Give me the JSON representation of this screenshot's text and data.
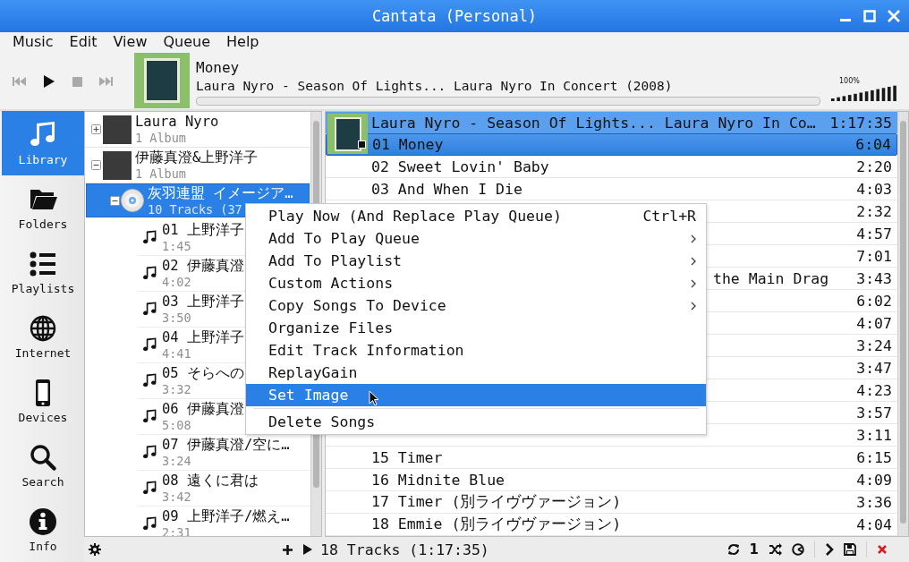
{
  "window": {
    "title": "Cantata (Personal)"
  },
  "menu_bar": [
    {
      "label": "Music"
    },
    {
      "label": "Edit"
    },
    {
      "label": "View"
    },
    {
      "label": "Queue"
    },
    {
      "label": "Help"
    }
  ],
  "transport": [
    {
      "kind": "previous",
      "disabled": true
    },
    {
      "kind": "play",
      "disabled": false
    },
    {
      "kind": "stop",
      "disabled": true
    },
    {
      "kind": "next",
      "disabled": true
    }
  ],
  "now_playing": {
    "title": "Money",
    "subtitle": "Laura Nyro - Season Of Lights... Laura Nyro In Concert (2008)",
    "level": 0
  },
  "volume": {
    "reading": "100%",
    "level": 1
  },
  "sidebar": {
    "items": [
      {
        "label": "Library",
        "selected": true
      },
      {
        "label": "Folders",
        "selected": false
      },
      {
        "label": "Playlists",
        "selected": false
      },
      {
        "label": "Internet",
        "selected": false
      },
      {
        "label": "Devices",
        "selected": false
      },
      {
        "label": "Search",
        "selected": false
      },
      {
        "label": "Info",
        "selected": false
      }
    ]
  },
  "library": {
    "artists": [
      {
        "name": "Laura Nyro",
        "subtitle": "1 Album",
        "expanded": false
      },
      {
        "name": "伊藤真澄&上野洋子",
        "subtitle": "1 Album",
        "expanded": true,
        "children": [
          {
            "title": "灰羽連盟 イメージア…",
            "subtitle": "10 Tracks (37",
            "expanded": true,
            "selected": true,
            "children": [
              {
                "title": "01 上野洋子",
                "duration": "1:45"
              },
              {
                "title": "02 伊藤真澄",
                "duration": "4:02"
              },
              {
                "title": "03 上野洋子",
                "duration": "3:50"
              },
              {
                "title": "04 上野洋子",
                "duration": "4:41"
              },
              {
                "title": "05 そらへの",
                "duration": "3:32"
              },
              {
                "title": "06 伊藤真澄",
                "duration": "5:08"
              },
              {
                "title": "07 伊藤真澄/空に…",
                "duration": "3:24"
              },
              {
                "title": "08 遠くに君は",
                "duration": "3:42"
              },
              {
                "title": "09 上野洋子/燃え…",
                "duration": "2:31"
              }
            ]
          }
        ]
      }
    ]
  },
  "play_queue": {
    "header": {
      "title": "Laura Nyro - Season Of Lights... Laura Nyro In Co…",
      "duration": "1:17:35",
      "selected": true
    },
    "rows": [
      {
        "kind": "full",
        "title": "01 Money",
        "duration": "6:04",
        "selected": true,
        "playing": true
      },
      {
        "kind": "full",
        "title": "02 Sweet Lovin' Baby",
        "duration": "2:20",
        "selected": false,
        "playing": false
      },
      {
        "kind": "full",
        "title": "03 And When I Die",
        "duration": "4:03",
        "selected": false,
        "playing": false
      },
      {
        "kind": "covered",
        "duration": "2:32"
      },
      {
        "kind": "covered",
        "duration": "4:57"
      },
      {
        "kind": "covered",
        "duration": "7:01"
      },
      {
        "kind": "covered",
        "title": "the Main Drag",
        "duration": "3:43"
      },
      {
        "kind": "covered",
        "duration": "6:02"
      },
      {
        "kind": "covered",
        "duration": "4:07"
      },
      {
        "kind": "covered",
        "duration": "3:24"
      },
      {
        "kind": "covered",
        "duration": "3:47"
      },
      {
        "kind": "covered",
        "duration": "4:23"
      },
      {
        "kind": "covered",
        "duration": "3:57"
      },
      {
        "kind": "covered",
        "duration": "3:11"
      },
      {
        "kind": "full",
        "title": "15 Timer",
        "duration": "6:15",
        "selected": false,
        "playing": false
      },
      {
        "kind": "full",
        "title": "16 Midnite Blue",
        "duration": "4:09",
        "selected": false,
        "playing": false
      },
      {
        "kind": "full",
        "title": "17 Timer (別ライヴヴァージョン)",
        "duration": "3:36",
        "selected": false,
        "playing": false
      },
      {
        "kind": "full",
        "title": "18 Emmie (別ライヴヴァージョン)",
        "duration": "4:04",
        "selected": false,
        "playing": false
      }
    ]
  },
  "status_bar": {
    "summary": "18 Tracks (1:17:35)",
    "single_label": "1"
  },
  "context_menu": [
    {
      "kind": "item",
      "label": "Play Now (And Replace Play Queue)",
      "shortcut": "Ctrl+R",
      "submenu": false,
      "selected": false
    },
    {
      "kind": "item",
      "label": "Add To Play Queue",
      "submenu": true,
      "selected": false
    },
    {
      "kind": "item",
      "label": "Add To Playlist",
      "submenu": true,
      "selected": false
    },
    {
      "kind": "item",
      "label": "Custom Actions",
      "submenu": true,
      "selected": false
    },
    {
      "kind": "item",
      "label": "Copy Songs To Device",
      "submenu": true,
      "selected": false
    },
    {
      "kind": "item",
      "label": "Organize Files",
      "submenu": false,
      "selected": false
    },
    {
      "kind": "item",
      "label": "Edit Track Information",
      "submenu": false,
      "selected": false
    },
    {
      "kind": "item",
      "label": "ReplayGain",
      "submenu": false,
      "selected": false
    },
    {
      "kind": "item",
      "label": "Set Image",
      "submenu": false,
      "selected": true
    },
    {
      "kind": "separator"
    },
    {
      "kind": "item",
      "label": "Delete Songs",
      "submenu": false,
      "selected": false
    }
  ]
}
